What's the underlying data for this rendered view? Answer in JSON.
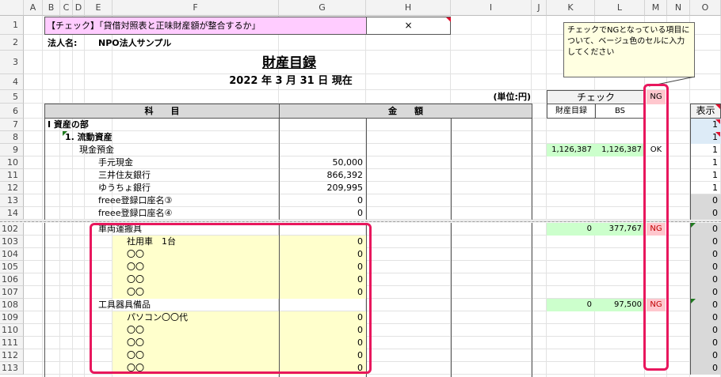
{
  "columns": [
    "A",
    "B",
    "C",
    "D",
    "E",
    "F",
    "G",
    "H",
    "I",
    "J",
    "K",
    "L",
    "M",
    "N",
    "O"
  ],
  "rows_top": [
    "1",
    "2",
    "3",
    "4",
    "5",
    "6",
    "7",
    "8",
    "9",
    "10",
    "11",
    "12",
    "13",
    "14"
  ],
  "rows_bottom": [
    "102",
    "103",
    "104",
    "105",
    "106",
    "107",
    "108",
    "109",
    "110",
    "111",
    "112",
    "113"
  ],
  "header": {
    "check_title": "【チェック】「貸借対照表と正味財産額が整合するか」",
    "check_result": "×",
    "corp_label": "法人名:",
    "corp_name": "NPO法人サンプル",
    "doc_title": "財産目録",
    "date_text": "2022  年  3  月  31  日  現在",
    "unit": "(単位:円)"
  },
  "table_header": {
    "subject": "科　　目",
    "amount": "金　　額"
  },
  "check_panel": {
    "title": "チェック",
    "col1": "財産目録",
    "col2": "BS",
    "ng_header": "NG",
    "display_header": "表示"
  },
  "note": "チェックでNGとなっている項目について、ベージュ色のセルに入力してください",
  "sections": {
    "section1": "I  資産の部",
    "section2": "1.  流動資産"
  },
  "top_items": [
    {
      "label": "現金預金",
      "amount": "",
      "k": "1,126,387",
      "l": "1,126,387",
      "m": "OK",
      "o": "1"
    },
    {
      "label": "手元現金",
      "amount": "50,000",
      "k": "",
      "l": "",
      "m": "",
      "o": "1"
    },
    {
      "label": "三井住友銀行",
      "amount": "866,392",
      "k": "",
      "l": "",
      "m": "",
      "o": "1"
    },
    {
      "label": "ゆうちょ銀行",
      "amount": "209,995",
      "k": "",
      "l": "",
      "m": "",
      "o": "1"
    },
    {
      "label": "freee登録口座名③",
      "amount": "0",
      "k": "",
      "l": "",
      "m": "",
      "o": "0"
    },
    {
      "label": "freee登録口座名④",
      "amount": "0",
      "k": "",
      "l": "",
      "m": "",
      "o": "0"
    }
  ],
  "display_top": [
    "1",
    "1"
  ],
  "bottom_items": [
    {
      "label": "車両運搬具",
      "amount": "",
      "k": "0",
      "l": "377,767",
      "m": "NG",
      "o": "0",
      "indent": 1
    },
    {
      "label": "社用車　1台",
      "amount": "0",
      "k": "",
      "l": "",
      "m": "",
      "o": "0",
      "indent": 2
    },
    {
      "label": "〇〇",
      "amount": "0",
      "k": "",
      "l": "",
      "m": "",
      "o": "0",
      "indent": 2
    },
    {
      "label": "〇〇",
      "amount": "0",
      "k": "",
      "l": "",
      "m": "",
      "o": "0",
      "indent": 2
    },
    {
      "label": "〇〇",
      "amount": "0",
      "k": "",
      "l": "",
      "m": "",
      "o": "0",
      "indent": 2
    },
    {
      "label": "〇〇",
      "amount": "0",
      "k": "",
      "l": "",
      "m": "",
      "o": "0",
      "indent": 2
    },
    {
      "label": "工具器具備品",
      "amount": "",
      "k": "0",
      "l": "97,500",
      "m": "NG",
      "o": "0",
      "indent": 1
    },
    {
      "label": "パソコン〇〇代",
      "amount": "0",
      "k": "",
      "l": "",
      "m": "",
      "o": "0",
      "indent": 2
    },
    {
      "label": "〇〇",
      "amount": "0",
      "k": "",
      "l": "",
      "m": "",
      "o": "0",
      "indent": 2
    },
    {
      "label": "〇〇",
      "amount": "0",
      "k": "",
      "l": "",
      "m": "",
      "o": "0",
      "indent": 2
    },
    {
      "label": "〇〇",
      "amount": "0",
      "k": "",
      "l": "",
      "m": "",
      "o": "0",
      "indent": 2
    },
    {
      "label": "〇〇",
      "amount": "0",
      "k": "",
      "l": "",
      "m": "",
      "o": "0",
      "indent": 2
    }
  ],
  "colors": {
    "highlight": "#e8175d",
    "pink_cell": "#ffccff",
    "beige": "#ffffcc",
    "green": "#ccffcc",
    "ng_pink": "#ffc7ce"
  }
}
